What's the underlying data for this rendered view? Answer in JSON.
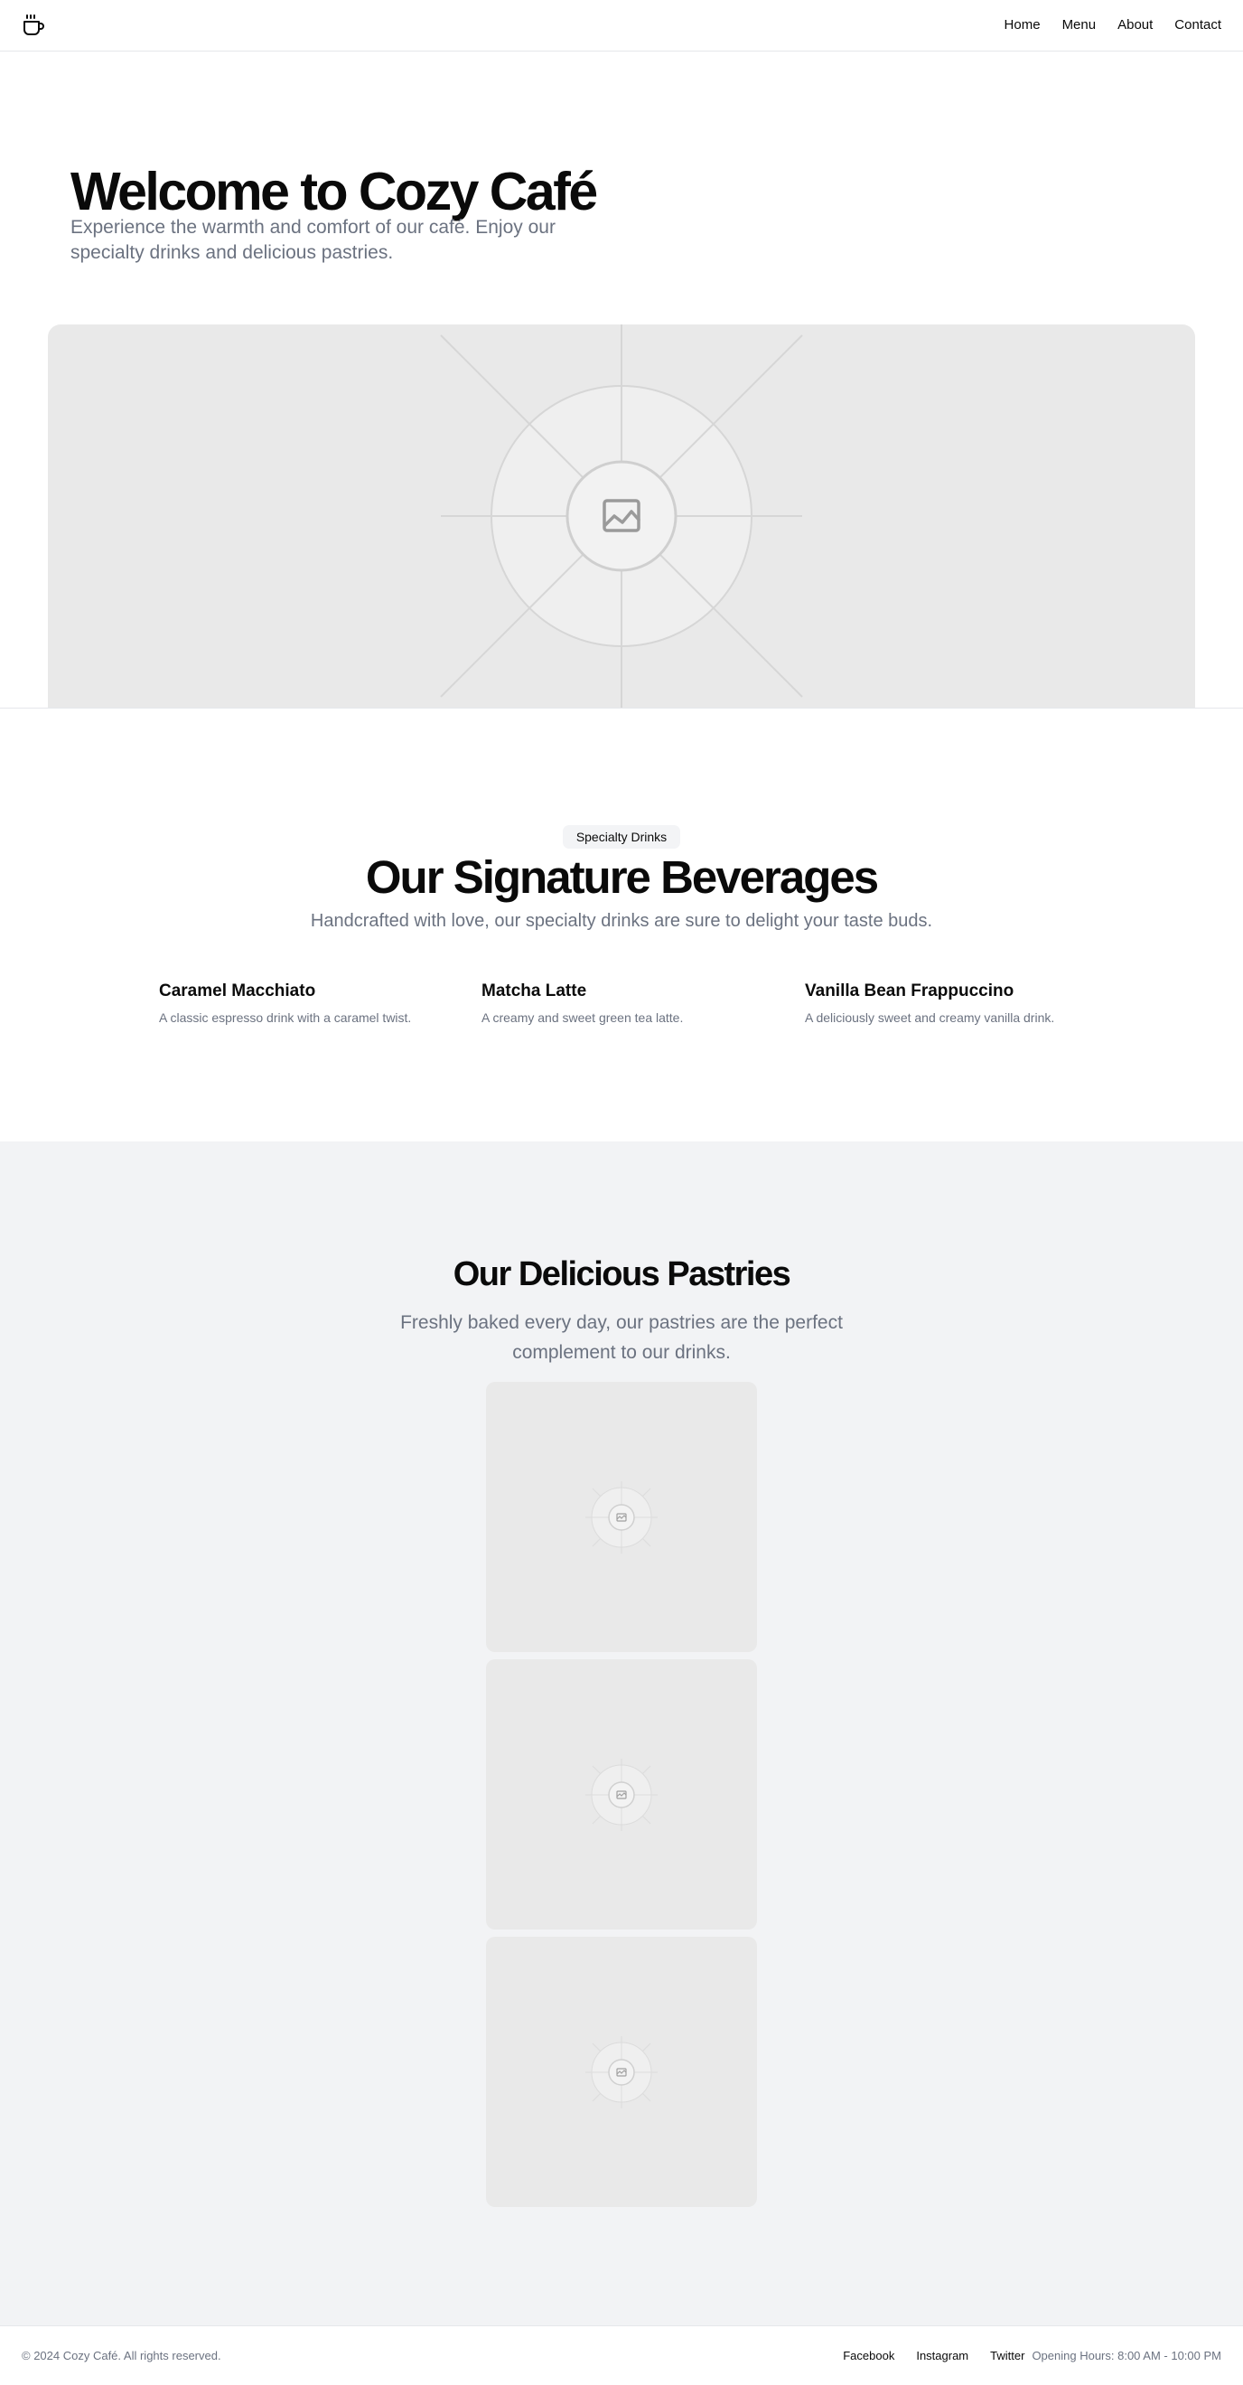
{
  "header": {
    "logo_icon": "coffee-cup-icon",
    "nav": [
      "Home",
      "Menu",
      "About",
      "Contact"
    ]
  },
  "hero": {
    "title": "Welcome to Cozy Café",
    "subtitle": "Experience the warmth and comfort of our café. Enjoy our specialty drinks and delicious pastries.",
    "image_icon": "image-placeholder-icon"
  },
  "beverages": {
    "badge": "Specialty Drinks",
    "title": "Our Signature Beverages",
    "subtitle": "Handcrafted with love, our specialty drinks are sure to delight your taste buds.",
    "drinks": [
      {
        "name": "Caramel Macchiato",
        "description": "A classic espresso drink with a caramel twist."
      },
      {
        "name": "Matcha Latte",
        "description": "A creamy and sweet green tea latte."
      },
      {
        "name": "Vanilla Bean Frappuccino",
        "description": "A deliciously sweet and creamy vanilla drink."
      }
    ]
  },
  "pastries": {
    "title": "Our Delicious Pastries",
    "subtitle": "Freshly baked every day, our pastries are the perfect complement to our drinks.",
    "image_icon": "image-placeholder-icon",
    "card_count": 3
  },
  "footer": {
    "copyright": "© 2024 Cozy Café. All rights reserved.",
    "links": [
      "Facebook",
      "Instagram",
      "Twitter"
    ],
    "hours": "Opening Hours: 8:00 AM - 10:00 PM"
  },
  "colors": {
    "text": "#0a0a0a",
    "muted": "#6b7280",
    "border": "#e5e7eb",
    "placeholder_bg": "#e9e9e9",
    "section_bg": "#f2f3f5",
    "badge_bg": "#f3f4f6"
  }
}
